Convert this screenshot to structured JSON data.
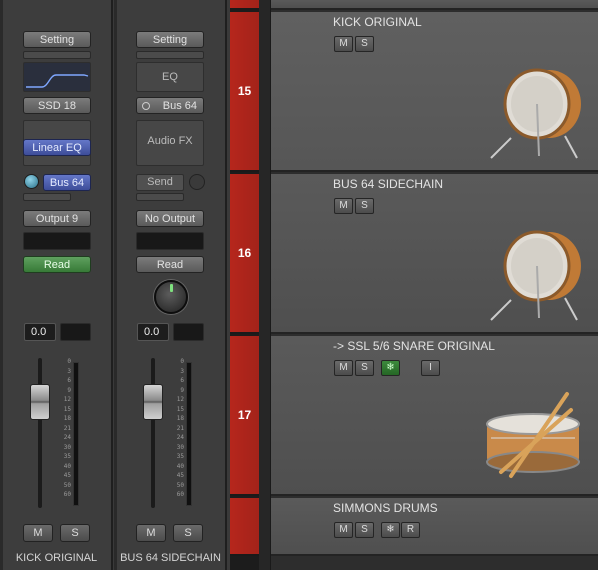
{
  "mixer": {
    "strips": [
      {
        "setting_label": "Setting",
        "input_label": "SSD 18",
        "plugin_label": "Linear EQ",
        "send_label": "Bus 64",
        "output_label": "Output 9",
        "automation_label": "Read",
        "automation_color": "#4a8f4a",
        "pan_value": "0.0",
        "mute_label": "M",
        "solo_label": "S",
        "name": "KICK ORIGINAL"
      },
      {
        "setting_label": "Setting",
        "eq_label": "EQ",
        "input_label": "Bus 64",
        "audiofx_label": "Audio FX",
        "send_label": "Send",
        "output_label": "No Output",
        "automation_label": "Read",
        "pan_value": "0.0",
        "mute_label": "M",
        "solo_label": "S",
        "name": "BUS 64 SIDECHAIN"
      }
    ],
    "fader_scale": [
      "0",
      "3",
      "6",
      "9",
      "12",
      "15",
      "18",
      "21",
      "24",
      "30",
      "35",
      "40",
      "45",
      "50",
      "60"
    ]
  },
  "tracks": [
    {
      "number": "15",
      "name": "KICK ORIGINAL",
      "mute": "M",
      "solo": "S",
      "icon": "kick-drum-icon"
    },
    {
      "number": "16",
      "name": "BUS 64 SIDECHAIN",
      "mute": "M",
      "solo": "S",
      "icon": "kick-drum-icon"
    },
    {
      "number": "17",
      "name": "-> SSL 5/6 SNARE ORIGINAL",
      "mute": "M",
      "solo": "S",
      "freeze": "❄",
      "input": "I",
      "icon": "snare-drum-icon"
    },
    {
      "number": "",
      "name": "SIMMONS DRUMS",
      "mute": "M",
      "solo": "S",
      "freeze": "❄",
      "record": "R"
    }
  ],
  "colors": {
    "track_number_bg": "#b6261c",
    "plugin_blue": "#5060b0",
    "read_green": "#4a8f4a",
    "freeze_green": "#2f7a2f"
  }
}
